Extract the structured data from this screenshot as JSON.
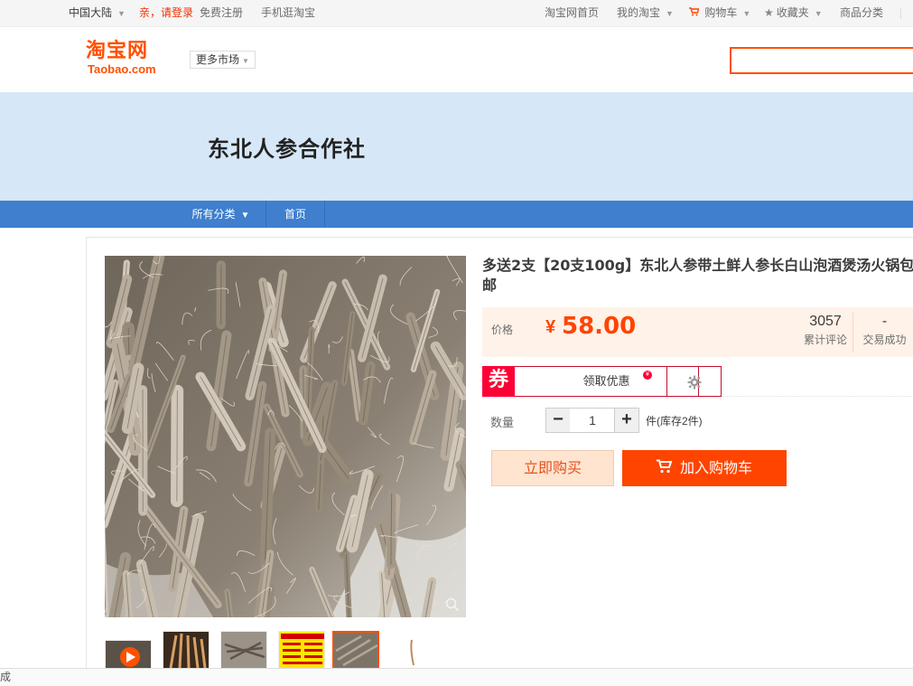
{
  "topbar": {
    "region": "中国大陆",
    "login": "亲，请登录",
    "register": "免费注册",
    "mobile": "手机逛淘宝",
    "home": "淘宝网首页",
    "my_taobao": "我的淘宝",
    "cart": "购物车",
    "favorites": "收藏夹",
    "categories": "商品分类"
  },
  "header": {
    "logo_cn": "淘宝网",
    "logo_en": "Taobao.com",
    "more_market": "更多市场",
    "search_placeholder": ""
  },
  "shop": {
    "name": "东北人参合作社"
  },
  "nav": {
    "all_categories": "所有分类",
    "home": "首页"
  },
  "product": {
    "title": "多送2支【20支100g】东北人参带土鲜人参长白山泡酒煲汤火锅包邮",
    "price_label": "价格",
    "price_currency": "¥",
    "price": "58.00",
    "reviews_count": "3057",
    "reviews_label": "累计评论",
    "deals_count": "-",
    "deals_label": "交易成功",
    "coupon_tag": "券",
    "coupon_button": "领取优惠",
    "quantity_label": "数量",
    "quantity_value": "1",
    "stock_text": "件(库存2件)",
    "buy_now": "立即购买",
    "add_to_cart": "加入购物车"
  },
  "colors": {
    "accent": "#ff4400",
    "nav_blue": "#3f7fce",
    "banner_bg": "#d6e7f8",
    "coupon_red": "#ff0036"
  },
  "status_bar": {
    "text": "成"
  }
}
